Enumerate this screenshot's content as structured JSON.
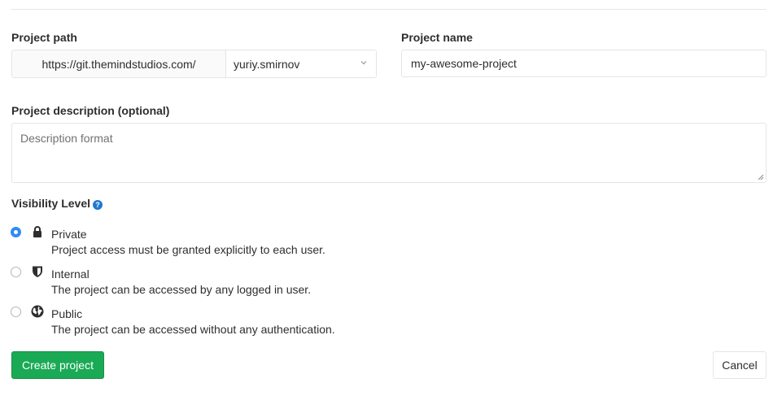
{
  "path": {
    "label": "Project path",
    "prefix": "https://git.themindstudios.com/",
    "namespace": "yuriy.smirnov"
  },
  "name": {
    "label": "Project name",
    "value": "my-awesome-project"
  },
  "description": {
    "label": "Project description (optional)",
    "placeholder": "Description format"
  },
  "visibility": {
    "label": "Visibility Level",
    "help_glyph": "?",
    "options": [
      {
        "title": "Private",
        "description": "Project access must be granted explicitly to each user.",
        "icon": "lock-icon",
        "selected": true
      },
      {
        "title": "Internal",
        "description": "The project can be accessed by any logged in user.",
        "icon": "shield-icon",
        "selected": false
      },
      {
        "title": "Public",
        "description": "The project can be accessed without any authentication.",
        "icon": "globe-icon",
        "selected": false
      }
    ]
  },
  "actions": {
    "create_label": "Create project",
    "cancel_label": "Cancel"
  },
  "colors": {
    "primary_green": "#1aaa55",
    "radio_blue": "#2f8bf5",
    "help_blue": "#1f78d1",
    "border": "#e5e5e5"
  }
}
